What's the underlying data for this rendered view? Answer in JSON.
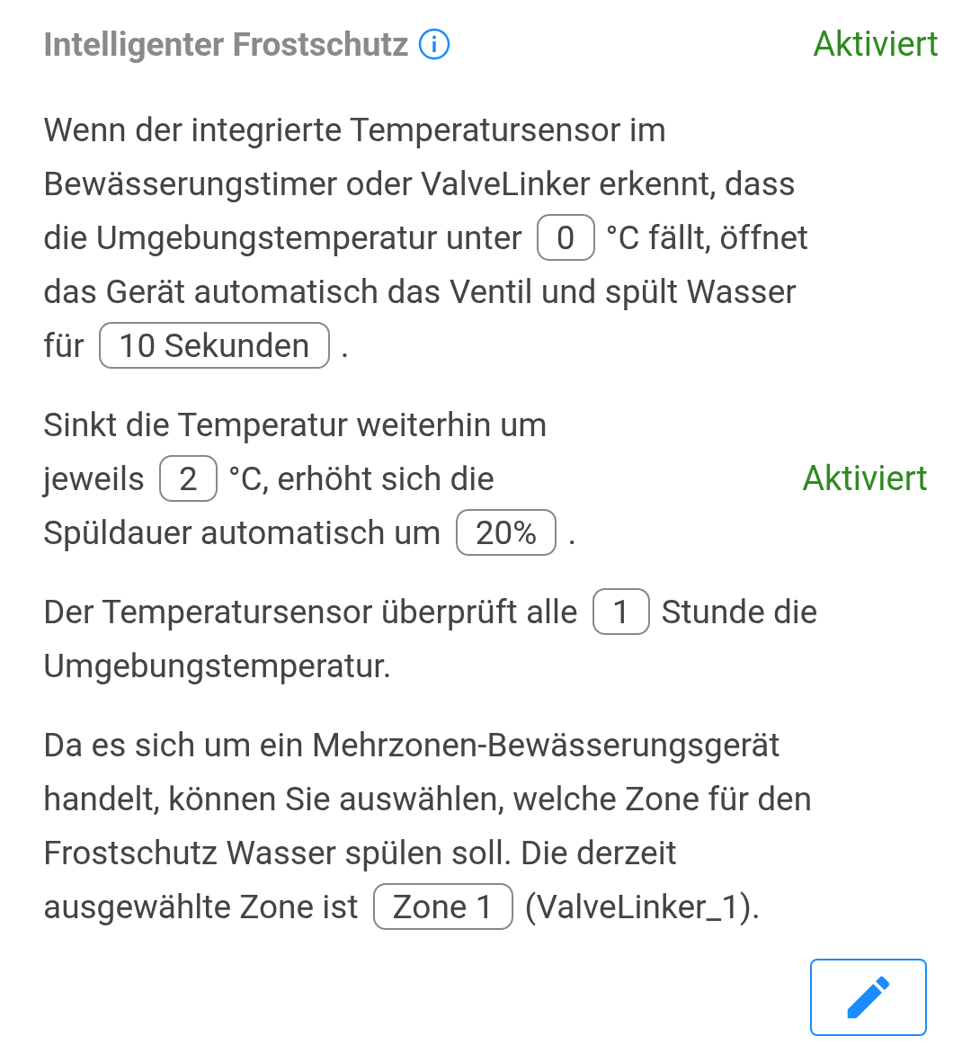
{
  "header": {
    "title": "Intelligenter Frostschutz",
    "status": "Aktiviert"
  },
  "paragraphs": [
    {
      "lines": [
        [
          {
            "kind": "text",
            "text": "Wenn der integrierte Temperatursensor im"
          }
        ],
        [
          {
            "kind": "text",
            "text": "Bewässerungstimer oder ValveLinker erkennt, dass"
          }
        ],
        [
          {
            "kind": "text",
            "text": "die Umgebungstemperatur unter"
          },
          {
            "kind": "value",
            "text": "0"
          },
          {
            "kind": "text",
            "text": "°C fällt, öffnet"
          }
        ],
        [
          {
            "kind": "text",
            "text": "das Gerät automatisch das Ventil und spült Wasser"
          }
        ],
        [
          {
            "kind": "text",
            "text": "für"
          },
          {
            "kind": "value",
            "text": "10 Sekunden"
          },
          {
            "kind": "text",
            "text": "."
          }
        ]
      ]
    },
    {
      "status": "Aktiviert",
      "lines": [
        [
          {
            "kind": "text",
            "text": "Sinkt die Temperatur weiterhin um"
          }
        ],
        [
          {
            "kind": "text",
            "text": "jeweils"
          },
          {
            "kind": "value",
            "text": "2"
          },
          {
            "kind": "text",
            "text": "°C, erhöht sich die"
          }
        ],
        [
          {
            "kind": "text",
            "text": "Spüldauer automatisch um"
          },
          {
            "kind": "value",
            "text": "20%"
          },
          {
            "kind": "text",
            "text": "."
          }
        ]
      ]
    },
    {
      "lines": [
        [
          {
            "kind": "text",
            "text": "Der Temperatursensor überprüft alle"
          },
          {
            "kind": "value",
            "text": "1"
          },
          {
            "kind": "text",
            "text": "Stunde die"
          }
        ],
        [
          {
            "kind": "text",
            "text": "Umgebungstemperatur."
          }
        ]
      ]
    },
    {
      "lines": [
        [
          {
            "kind": "text",
            "text": "Da es sich um ein Mehrzonen-Bewässerungsgerät"
          }
        ],
        [
          {
            "kind": "text",
            "text": "handelt, können Sie auswählen, welche Zone für den"
          }
        ],
        [
          {
            "kind": "text",
            "text": "Frostschutz Wasser spülen soll. Die derzeit"
          }
        ],
        [
          {
            "kind": "text",
            "text": "ausgewählte Zone ist"
          },
          {
            "kind": "value",
            "text": "Zone 1"
          },
          {
            "kind": "text",
            "text": "(ValveLinker_1)."
          }
        ]
      ]
    }
  ]
}
